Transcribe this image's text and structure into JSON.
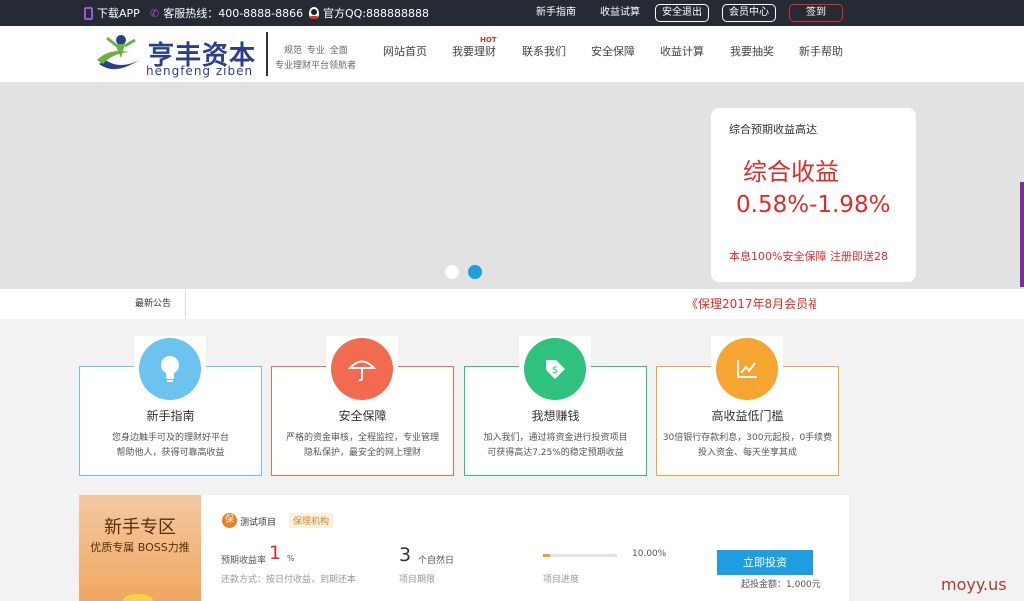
{
  "topbar": {
    "app_label": "下载APP",
    "hotline": "客服热线：400-8888-8866",
    "qq": "官方QQ:888888888",
    "links": [
      "新手指南",
      "收益试算"
    ],
    "logout": "安全退出",
    "member": "会员中心",
    "signin": "签到"
  },
  "header": {
    "logo_cn": "亨丰资本",
    "logo_en": "hengfeng ziben",
    "slogan_line1": "规范 专业 全面",
    "slogan_line2": "专业理财平台领航者",
    "nav": [
      "网站首页",
      "我要理财",
      "联系我们",
      "安全保障",
      "收益计算",
      "我要抽奖",
      "新手帮助"
    ],
    "hot_badge": "HOT"
  },
  "banner": {
    "card_sub": "综合预期收益高达",
    "card_title": "综合收益",
    "card_rate": "0.58%-1.98%",
    "card_note": "本息100%安全保障 注册即送28"
  },
  "notice": {
    "label": "最新公告",
    "text": "《保理2017年8月会员福"
  },
  "features": [
    {
      "title": "新手指南",
      "desc1": "您身边触手可及的理财好平台",
      "desc2": "帮助他人，获得可靠高收益",
      "color": "#6cc3ef",
      "icon": "lightbulb-icon"
    },
    {
      "title": "安全保障",
      "desc1": "严格的资金审核，全程监控，专业管理",
      "desc2": "隐私保护，最安全的网上理财",
      "color": "#f26a4f",
      "icon": "umbrella-icon"
    },
    {
      "title": "我想赚钱",
      "desc1": "加入我们，通过将资金进行投资项目",
      "desc2": "可获得高达7.25%的稳定预期收益",
      "color": "#2ec27e",
      "icon": "money-tag-icon"
    },
    {
      "title": "高收益低门槛",
      "desc1": "30倍银行存款利息，300元起投，0手续费",
      "desc2": "投入资金、每天坐享其成",
      "color": "#f6a531",
      "icon": "chart-icon"
    }
  ],
  "newbie": {
    "title": "新手专区",
    "subtitle": "优质专属 BOSS力推"
  },
  "product": {
    "badge": "保",
    "name": "测试项目",
    "tag": "保理机构",
    "rate_label": "预期收益率",
    "rate_value": "1",
    "rate_unit": "%",
    "repay": "还款方式：按日付收益，到期还本",
    "term_value": "3",
    "term_unit": "个自然日",
    "term_label": "项目期限",
    "progress_text": "10.00%",
    "progress_fraction": 0.1,
    "progress_label": "项目进度",
    "button": "立即投资",
    "min_amount": "起投金额：1,000元"
  },
  "watermark": "moyy.us"
}
